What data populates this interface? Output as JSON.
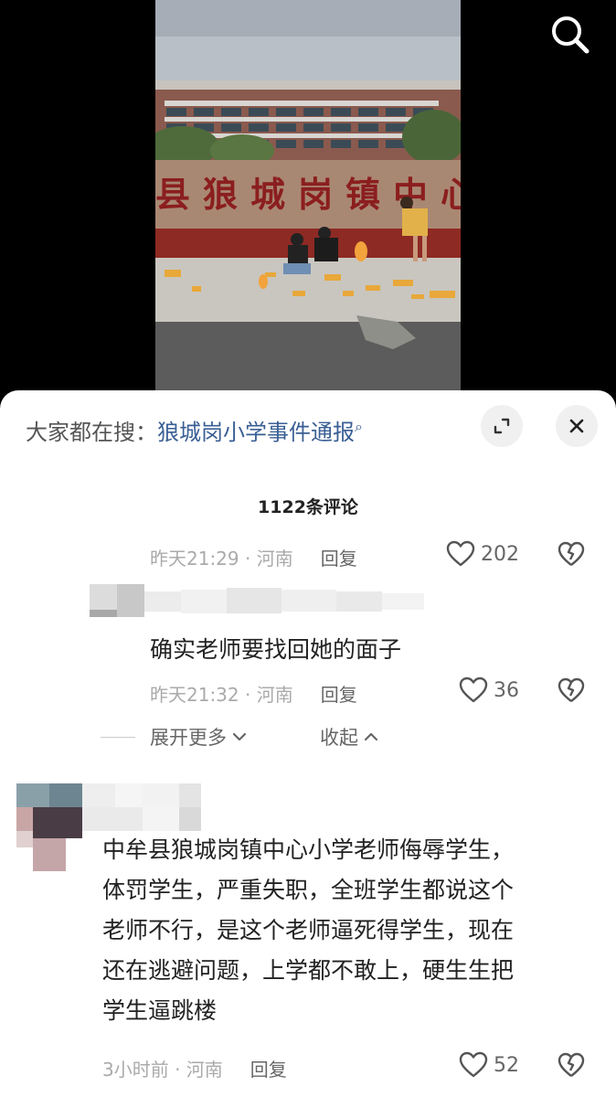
{
  "video": {
    "sign_text": "县狼城岗镇中心"
  },
  "search": {
    "icon": "search-icon"
  },
  "hot_search": {
    "prefix": "大家都在搜：",
    "query": "狼城岗小学事件通报",
    "icon": "search-small-icon"
  },
  "controls": {
    "expand_icon": "expand-icon",
    "close_icon": "close-icon"
  },
  "comment_count": "1122条评论",
  "comments": [
    {
      "meta": "昨天21:29 · 河南",
      "reply": "回复",
      "likes": "202"
    },
    {
      "text": "确实老师要找回她的面子",
      "meta": "昨天21:32 · 河南",
      "reply": "回复",
      "likes": "36"
    },
    {
      "text_lines": [
        "中牟县狼城岗镇中心小学老师侮辱学生，",
        "体罚学生，严重失职，全班学生都说这个",
        "老师不行，是这个老师逼死得学生，现在",
        "还在逃避问题，上学都不敢上，硬生生把",
        "学生逼跳楼"
      ],
      "meta": "3小时前 · 河南",
      "reply": "回复",
      "likes": "52"
    }
  ],
  "thread": {
    "expand_more": "展开更多",
    "collapse": "收起"
  },
  "colors": {
    "link": "#3a5f94",
    "meta": "#aaaaaa",
    "text": "#222222"
  }
}
